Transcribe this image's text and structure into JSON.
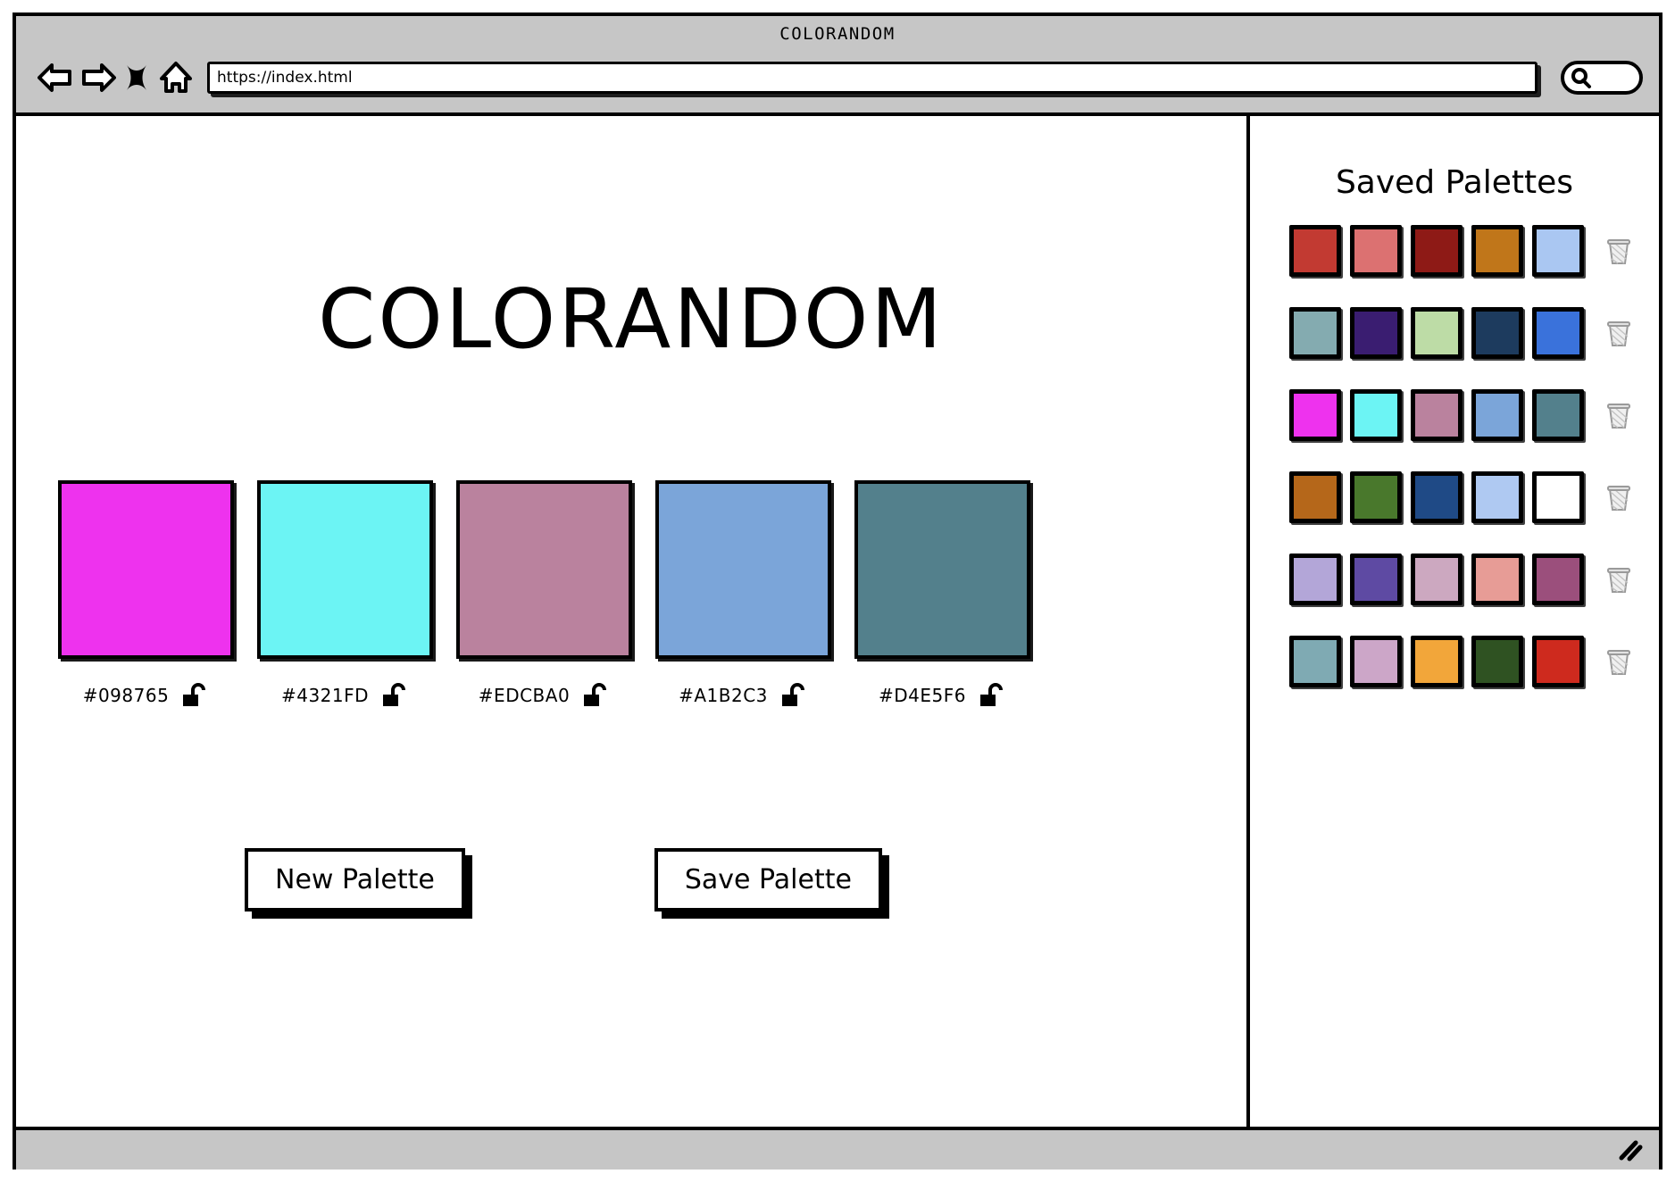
{
  "window": {
    "title": "COLORANDOM",
    "url_value": "https://index.html",
    "url_placeholder": "https://index.html"
  },
  "toolbar": {
    "back_icon": "back-arrow-icon",
    "forward_icon": "forward-arrow-icon",
    "stop_icon": "close-x-icon",
    "home_icon": "home-icon",
    "search_icon": "search-icon"
  },
  "app": {
    "title": "COLORANDOM"
  },
  "palette": {
    "swatches": [
      {
        "hex": "#098765",
        "color": "#EE32EE",
        "lock_icon": "unlocked-padlock-icon",
        "locked": false
      },
      {
        "hex": "#4321FD",
        "color": "#6CF4F4",
        "lock_icon": "unlocked-padlock-icon",
        "locked": false
      },
      {
        "hex": "#EDCBA0",
        "color": "#BA829E",
        "lock_icon": "unlocked-padlock-icon",
        "locked": false
      },
      {
        "hex": "#A1B2C3",
        "color": "#7BA5D9",
        "lock_icon": "unlocked-padlock-icon",
        "locked": false
      },
      {
        "hex": "#D4E5F6",
        "color": "#53808C",
        "lock_icon": "unlocked-padlock-icon",
        "locked": false
      }
    ]
  },
  "actions": {
    "new_palette_label": "New Palette",
    "save_palette_label": "Save Palette"
  },
  "sidebar": {
    "heading": "Saved Palettes",
    "delete_icon": "trash-can-icon",
    "rows": [
      {
        "colors": [
          "#C23A32",
          "#DC7171",
          "#8E1A16",
          "#C0761A",
          "#AAC7F2"
        ]
      },
      {
        "colors": [
          "#84ABB0",
          "#3A1D71",
          "#BDDCA6",
          "#1D3B5E",
          "#3A72DB"
        ]
      },
      {
        "colors": [
          "#EE32EE",
          "#6CF4F4",
          "#BA829E",
          "#7BA5D9",
          "#53808C"
        ]
      },
      {
        "colors": [
          "#B5671A",
          "#49782C",
          "#1F4A86",
          "#AFC9F2",
          "#EFC košt"
        ]
      },
      {
        "colors": [
          "#B3A6D8",
          "#5E4AA3",
          "#CCA8C0",
          "#E79C96",
          "#9B4F7C"
        ]
      },
      {
        "colors": [
          "#7FAAB3",
          "#CCA6C8",
          "#F2A63A",
          "#2F5222",
          "#CE2A1E"
        ]
      }
    ]
  },
  "status": {
    "resize_grip_icon": "resize-grip-icon"
  }
}
